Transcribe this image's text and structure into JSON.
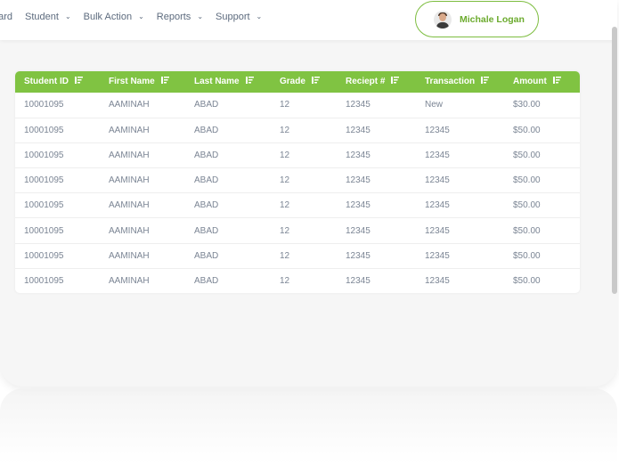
{
  "nav": {
    "items": [
      {
        "label": "oard",
        "has_dropdown": false
      },
      {
        "label": "Student",
        "has_dropdown": true
      },
      {
        "label": "Bulk Action",
        "has_dropdown": true
      },
      {
        "label": "Reports",
        "has_dropdown": true
      },
      {
        "label": "Support",
        "has_dropdown": true
      }
    ],
    "chevron": "⌄"
  },
  "user": {
    "name": "Michale Logan",
    "avatar_icon": "user-avatar"
  },
  "table": {
    "columns": [
      "Student ID",
      "First Name",
      "Last Name",
      "Grade",
      "Reciept #",
      "Transaction",
      "Amount"
    ],
    "rows": [
      [
        "10001095",
        "AAMINAH",
        "ABAD",
        "12",
        "12345",
        "New",
        "$30.00"
      ],
      [
        "10001095",
        "AAMINAH",
        "ABAD",
        "12",
        "12345",
        "12345",
        "$50.00"
      ],
      [
        "10001095",
        "AAMINAH",
        "ABAD",
        "12",
        "12345",
        "12345",
        "$50.00"
      ],
      [
        "10001095",
        "AAMINAH",
        "ABAD",
        "12",
        "12345",
        "12345",
        "$50.00"
      ],
      [
        "10001095",
        "AAMINAH",
        "ABAD",
        "12",
        "12345",
        "12345",
        "$50.00"
      ],
      [
        "10001095",
        "AAMINAH",
        "ABAD",
        "12",
        "12345",
        "12345",
        "$50.00"
      ],
      [
        "10001095",
        "AAMINAH",
        "ABAD",
        "12",
        "12345",
        "12345",
        "$50.00"
      ],
      [
        "10001095",
        "AAMINAH",
        "ABAD",
        "12",
        "12345",
        "12345",
        "$50.00"
      ]
    ]
  },
  "colors": {
    "accent": "#80c342",
    "accent_text": "#6cab2e",
    "cell_text": "#7b8594",
    "nav_text": "#5d6b7e"
  }
}
